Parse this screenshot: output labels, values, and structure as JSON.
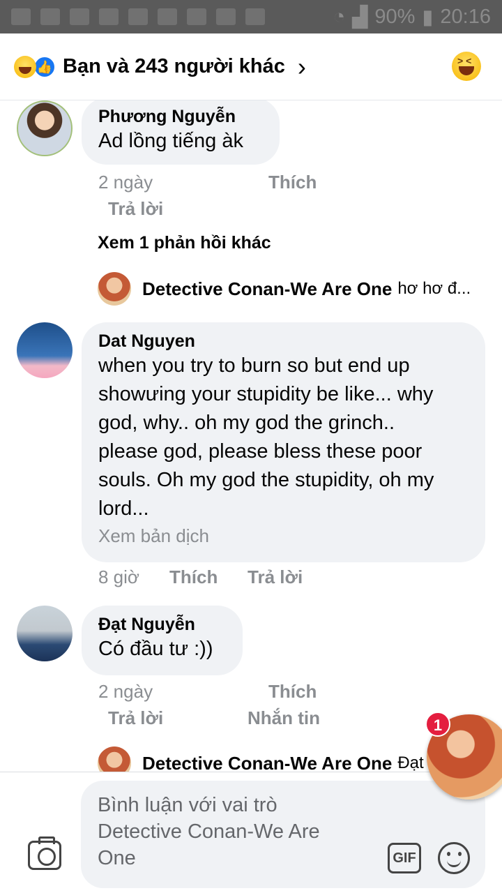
{
  "status_bar": {
    "battery": "90%",
    "time": "20:16"
  },
  "header": {
    "title": "Bạn và 243 người khác",
    "chevron": "›"
  },
  "comments": [
    {
      "name": "Phương Nguyễn",
      "text": "Ad lồng tiếng àk",
      "time": "2 ngày",
      "like": "Thích",
      "reply": "Trả lời",
      "more_replies": "Xem 1 phản hồi khác",
      "reply_preview": {
        "name": "Detective Conan-We Are One",
        "snippet": "hơ hơ đ..."
      }
    },
    {
      "name": "Dat Nguyen",
      "text_lines": [
        "when you try to burn so but end up",
        "showưing your stupidity be like... why",
        "god, why.. oh my god the grinch..",
        "please god, please bless these poor",
        "souls. Oh my god the stupidity, oh my",
        "lord..."
      ],
      "translate": "Xem bản dịch",
      "time": "8 giờ",
      "like": "Thích",
      "reply": "Trả lời"
    },
    {
      "name": "Đạt Nguyễn",
      "text": "Có đầu tư :))",
      "time": "2 ngày",
      "like": "Thích",
      "reply": "Trả lời",
      "message": "Nhắn tin",
      "reply_preview": {
        "name": "Detective Conan-We Are One",
        "snippet": "Đạt"
      }
    }
  ],
  "chat_head": {
    "badge": "1"
  },
  "composer": {
    "placeholder_lines": [
      "Bình luận với vai trò",
      "Detective Conan-We Are",
      "One"
    ],
    "gif_label": "GIF"
  }
}
